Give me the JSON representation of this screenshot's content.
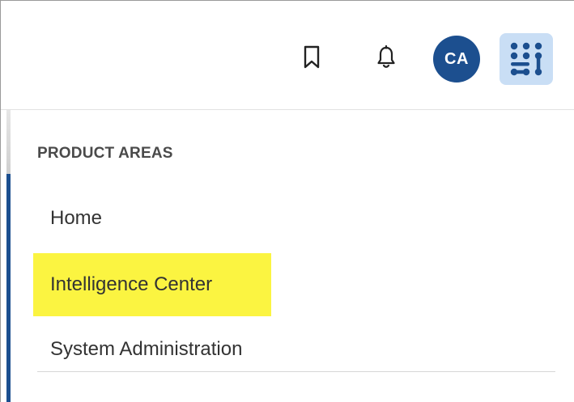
{
  "header": {
    "bookmark_icon": "bookmark-icon",
    "notifications_icon": "bell-icon",
    "avatar_initials": "CA",
    "avatar_color": "#1c4f8f",
    "apps_icon": "app-switcher-icon",
    "apps_bg_color": "#c9def5"
  },
  "menu": {
    "section_title": "PRODUCT AREAS",
    "items": [
      {
        "label": "Home"
      },
      {
        "label": "Intelligence Center",
        "highlighted": true
      },
      {
        "label": "System Administration"
      }
    ],
    "highlight_color": "#fbf441"
  }
}
